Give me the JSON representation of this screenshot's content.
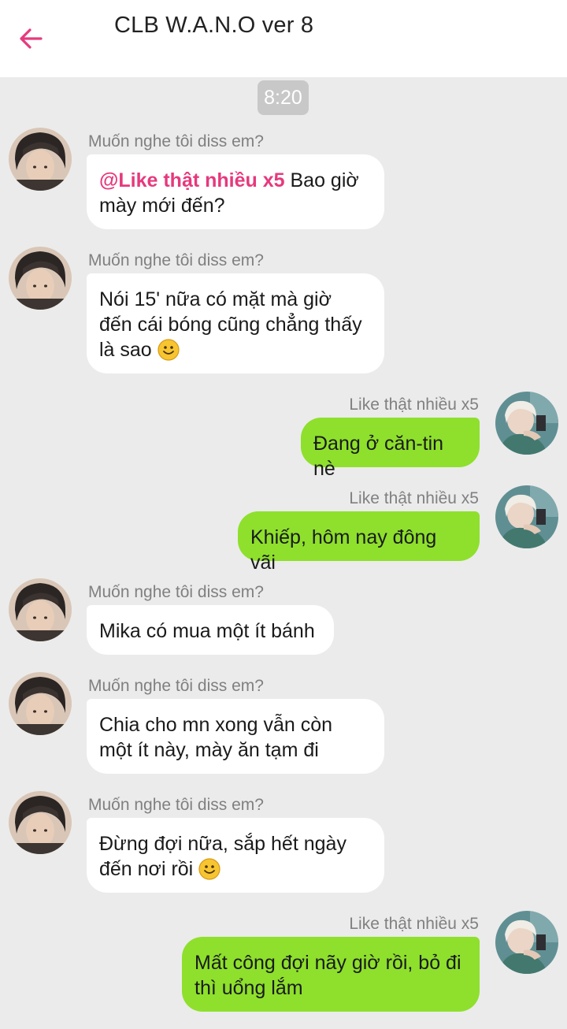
{
  "header": {
    "title": "CLB W.A.N.O ver 8"
  },
  "timestamp": "8:20",
  "messages": [
    {
      "sender": "Muốn nghe tôi diss em?",
      "mention": "@Like thật nhiều x5",
      "text": "Bao giờ",
      "text2": "mày mới đến?"
    },
    {
      "sender": "Muốn nghe tôi diss em?",
      "text": "Nói 15' nữa có mặt mà giờ",
      "text2": "đến cái bóng cũng chẳng thấy",
      "text3": "là sao"
    },
    {
      "sender": "Like thật nhiều x5",
      "text": "Đang ở căn-tin nè"
    },
    {
      "sender": "Like thật nhiều x5",
      "text": "Khiếp, hôm nay đông vãi"
    },
    {
      "sender": "Muốn nghe tôi diss em?",
      "text": "Mika có mua một ít bánh"
    },
    {
      "sender": "Muốn nghe tôi diss em?",
      "text": "Chia cho mn xong vẫn còn",
      "text2": "một ít này, mày ăn tạm đi"
    },
    {
      "sender": "Muốn nghe tôi diss em?",
      "text": "Đừng đợi nữa, sắp hết ngày",
      "text2": "đến nơi rồi"
    },
    {
      "sender": "Like thật nhiều x5",
      "text": "Mất công đợi nãy giờ rồi, bỏ đi",
      "text2": "thì uổng lắm"
    }
  ],
  "colors": {
    "accent": "#e6397d",
    "outgoing_bubble": "#8ee02c",
    "incoming_bubble": "#ffffff",
    "background": "#ebebeb"
  },
  "icons": {
    "back": "back-arrow-icon",
    "emoji": "smiley-emoji-icon"
  }
}
